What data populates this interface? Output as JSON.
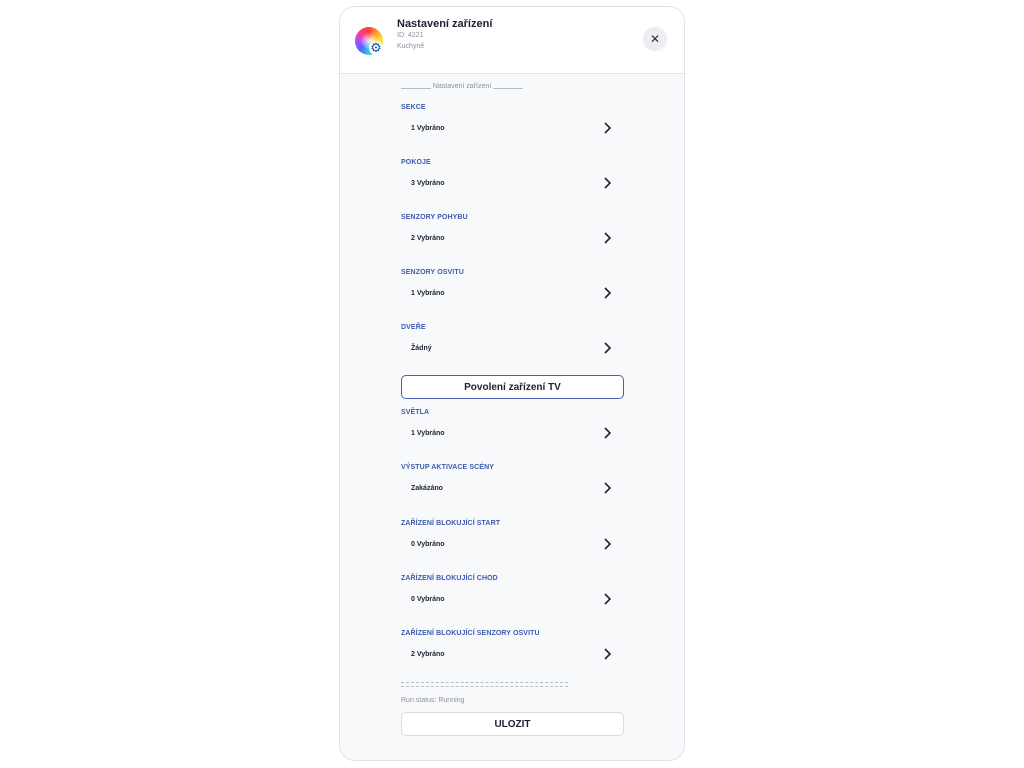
{
  "header": {
    "title": "Nastavení zařízení",
    "id_text": "ID: 4221",
    "room": "Kuchyně",
    "close_icon": "close-icon",
    "device_icon": "color-wheel-settings-icon"
  },
  "section_title": "Nastavení zařízení",
  "fields": [
    {
      "label": "SEKCE",
      "value": "1 Vybráno"
    },
    {
      "label": "POKOJE",
      "value": "3 Vybráno"
    },
    {
      "label": "SENZORY POHYBU",
      "value": "2 Vybráno"
    },
    {
      "label": "SENZORY OSVITU",
      "value": "1 Vybráno"
    },
    {
      "label": "DVEŘE",
      "value": "Žádný"
    },
    {
      "label": "SVĚTLA",
      "value": "1 Vybráno"
    },
    {
      "label": "VÝSTUP AKTIVACE SCÉNY",
      "value": "Zakázáno"
    },
    {
      "label": "ZAŘÍZENÍ BLOKUJÍCÍ START",
      "value": "0 Vybráno"
    },
    {
      "label": "ZAŘÍZENÍ BLOKUJÍCÍ CHOD",
      "value": "0 Vybráno"
    },
    {
      "label": "ZAŘÍZENÍ BLOKUJÍCÍ SENZORY OSVITU",
      "value": "2 Vybráno"
    }
  ],
  "tv_button": "Povolení zařízení TV",
  "run_status": "Run status: Running",
  "save_button": "ULOZIT",
  "colors": {
    "accent": "#3d5bb0",
    "panel_background": "#f8f9fb",
    "button_border": "#4a62b6"
  }
}
